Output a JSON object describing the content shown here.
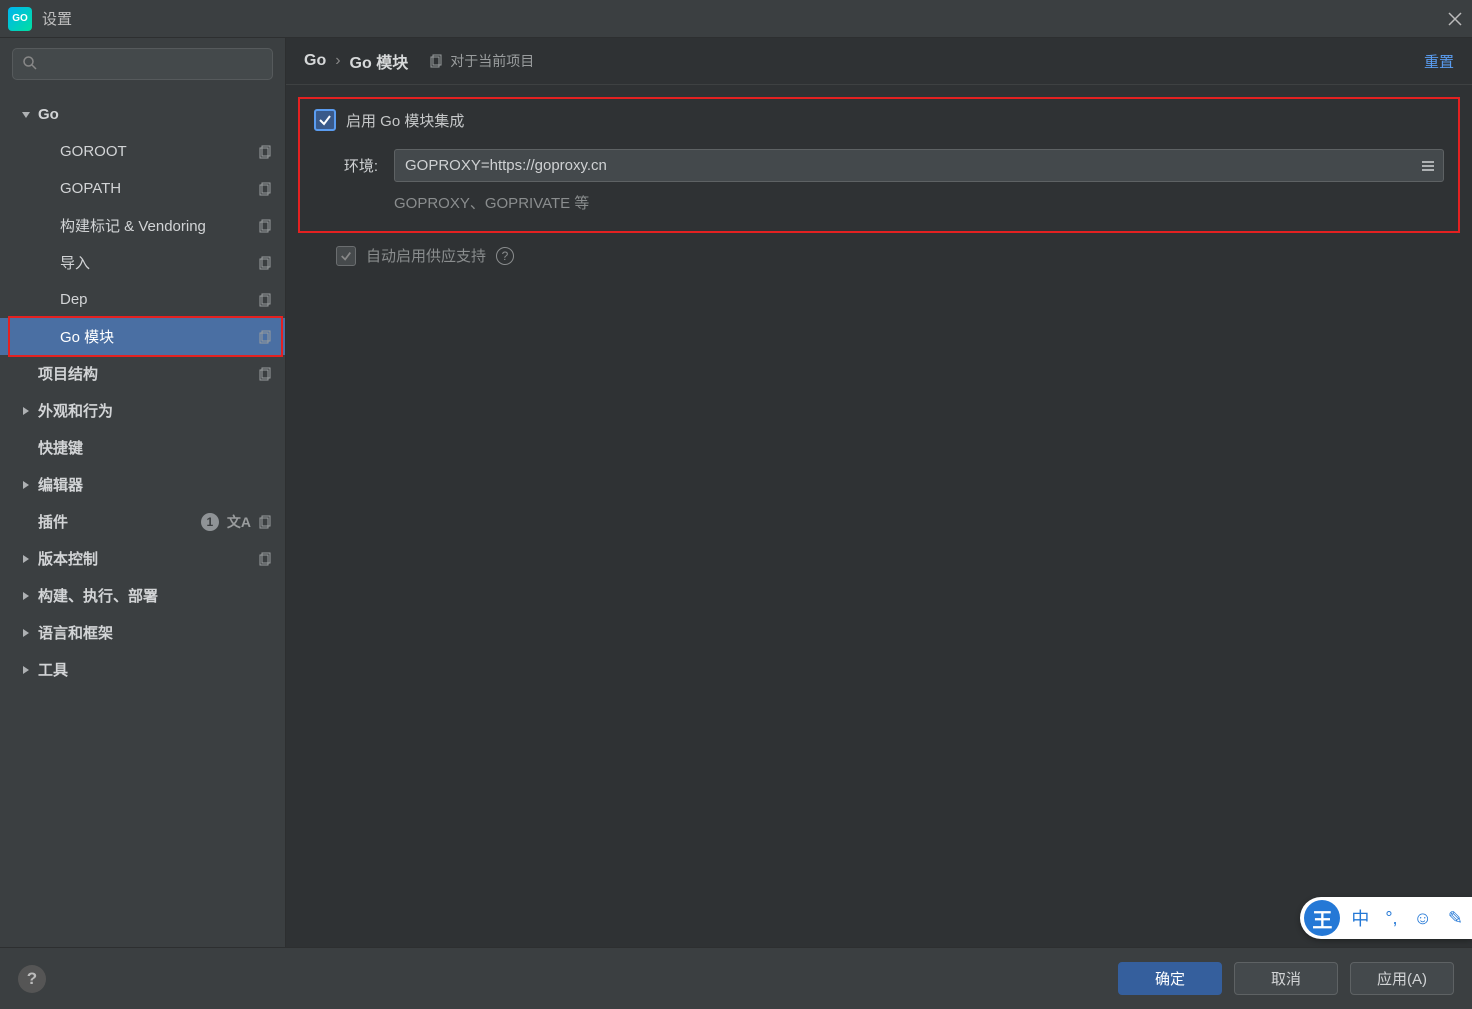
{
  "window": {
    "title": "设置"
  },
  "sidebar": {
    "search_placeholder": "",
    "tree": [
      {
        "label": "Go",
        "expandable": true,
        "expanded": true,
        "level": 1
      },
      {
        "label": "GOROOT",
        "level": 2,
        "copy": true
      },
      {
        "label": "GOPATH",
        "level": 2,
        "copy": true
      },
      {
        "label": "构建标记 & Vendoring",
        "level": 2,
        "copy": true
      },
      {
        "label": "导入",
        "level": 2,
        "copy": true
      },
      {
        "label": "Dep",
        "level": 2,
        "copy": true
      },
      {
        "label": "Go 模块",
        "level": 2,
        "copy": true,
        "selected": true,
        "outlined": true
      },
      {
        "label": "项目结构",
        "level": 1,
        "copy": true,
        "no_caret": true
      },
      {
        "label": "外观和行为",
        "level": 1,
        "expandable": true
      },
      {
        "label": "快捷键",
        "level": 1,
        "no_caret": true
      },
      {
        "label": "编辑器",
        "level": 1,
        "expandable": true
      },
      {
        "label": "插件",
        "level": 1,
        "no_caret": true,
        "badge": "1",
        "lang": true,
        "copy": true
      },
      {
        "label": "版本控制",
        "level": 1,
        "expandable": true,
        "copy": true
      },
      {
        "label": "构建、执行、部署",
        "level": 1,
        "expandable": true
      },
      {
        "label": "语言和框架",
        "level": 1,
        "expandable": true
      },
      {
        "label": "工具",
        "level": 1,
        "expandable": true
      }
    ]
  },
  "breadcrumb": {
    "items": [
      "Go",
      "Go 模块"
    ],
    "scope": "对于当前项目",
    "reset": "重置"
  },
  "form": {
    "enable_label": "启用 Go 模块集成",
    "env_label": "环境:",
    "env_value": "GOPROXY=https://goproxy.cn",
    "env_hint": "GOPROXY、GOPRIVATE 等",
    "auto_label": "自动启用供应支持"
  },
  "footer": {
    "ok": "确定",
    "cancel": "取消",
    "apply": "应用(A)"
  },
  "ime": {
    "main": "王",
    "lang": "中"
  }
}
